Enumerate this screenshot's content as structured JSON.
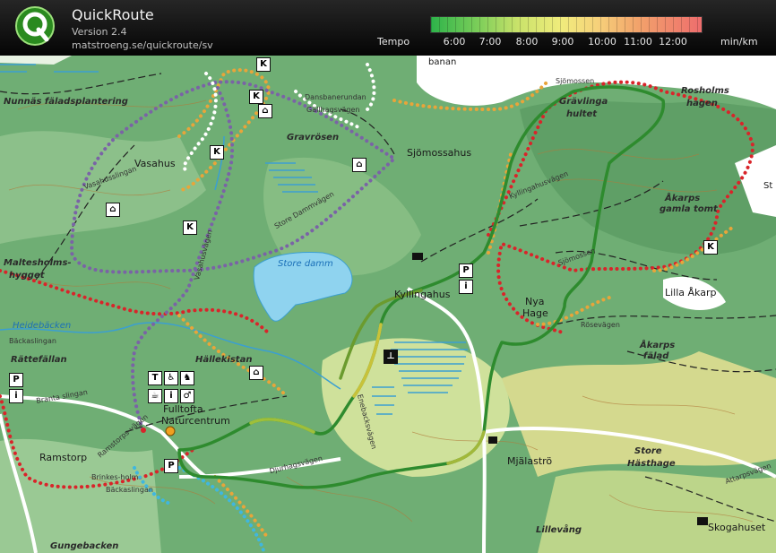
{
  "app": {
    "title": "QuickRoute",
    "version": "Version 2.4",
    "url": "matstroeng.se/quickroute/sv"
  },
  "legend": {
    "label": "Tempo",
    "ticks": [
      "6:00",
      "7:00",
      "8:00",
      "9:00",
      "10:00",
      "11:00",
      "12:00"
    ],
    "unit": "min/km"
  },
  "colors": {
    "route_fast": "#2e8b2e",
    "route_slow": "#ee6d6d",
    "trail_red": "#d9242a",
    "trail_orange": "#e8a53a",
    "trail_purple": "#7a63a6",
    "water": "#8fd3ef"
  },
  "map": {
    "places": {
      "nunnas": "Nunnäs fäladsplantering",
      "dansbane": "Dansbanerundan",
      "gallhagsvagen": "Gällhagsvägen",
      "gravrosen": "Gravrösen",
      "sjomossahus": "Sjömossahus",
      "sjomossen1": "Sjömossen",
      "gravlinga": "Grävlinga",
      "hultet": "hultet",
      "rosholms": "Rosholms",
      "hagen": "hagen",
      "banan": "banan",
      "vasahus": "Vasahus",
      "vasahusslingan": "Vasahusslingan",
      "store_dammvagen": "Store Dammvägen",
      "store_damm": "Store damm",
      "kyllingahusvagen": "Kyllingahusvägen",
      "akarps": "Åkarps",
      "gamla_tomt": "gamla tomt",
      "sjomossen2": "Sjömossen",
      "lilla_akarp": "Lilla Åkarp",
      "maltesholms": "Maltesholms-",
      "hygget": "hygget",
      "vasahusvagen": "Vasahusvägen",
      "kyllingahus": "Kyllingahus",
      "nya": "Nya",
      "hage": "Hage",
      "rosevagen": "Rösevägen",
      "akarps_falad1": "Åkarps",
      "akarps_falad2": "fälad",
      "heidebacken": "Heidebäcken",
      "backaslingan": "Bäckaslingan",
      "rattefallan": "Rättefällan",
      "hallekistan": "Hällekistan",
      "branta": "Branta slingan",
      "fulltofta1": "Fulltofta",
      "fulltofta2": "Naturcentrum",
      "enebacksvagen": "Enebacksvägen",
      "ramstorp": "Ramstorp",
      "ramstorpsvagen": "Ramstorps-vägen",
      "brinkesholm": "Brinkes-holm",
      "djurhagsvagen": "Djurhagsvägen",
      "mjalastro": "Mjälaströ",
      "store": "Store",
      "hasthage": "Hästhage",
      "attarpsvagen": "Attarpsvägen",
      "backaslingan2": "Bäckaslingan",
      "gungebacken": "Gungebacken",
      "lillevang": "Lillevång",
      "skogahuset": "Skogahuset",
      "st": "St"
    }
  }
}
